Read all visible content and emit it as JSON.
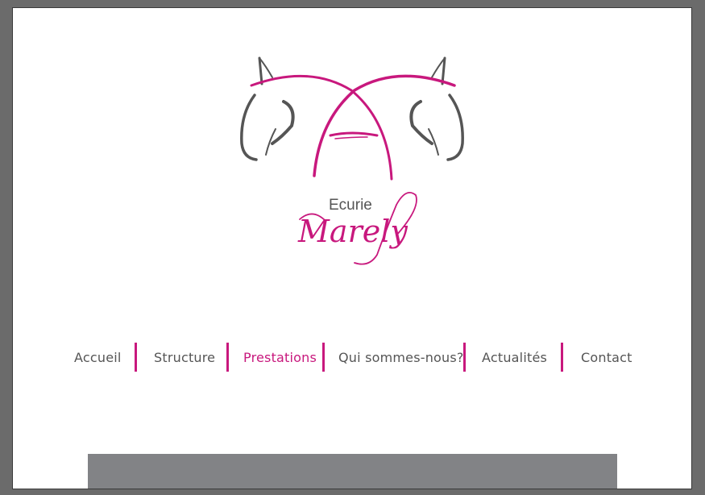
{
  "brand": {
    "line1": "Ecurie",
    "line2": "Marely",
    "accent_color": "#c8187d",
    "text_color": "#555555"
  },
  "nav": {
    "items": [
      {
        "label": "Accueil",
        "active": false
      },
      {
        "label": "Structure",
        "active": false
      },
      {
        "label": "Prestations",
        "active": true
      },
      {
        "label": "Qui sommes-nous?",
        "active": false
      },
      {
        "label": "Actualités",
        "active": false
      },
      {
        "label": "Contact",
        "active": false
      }
    ]
  }
}
